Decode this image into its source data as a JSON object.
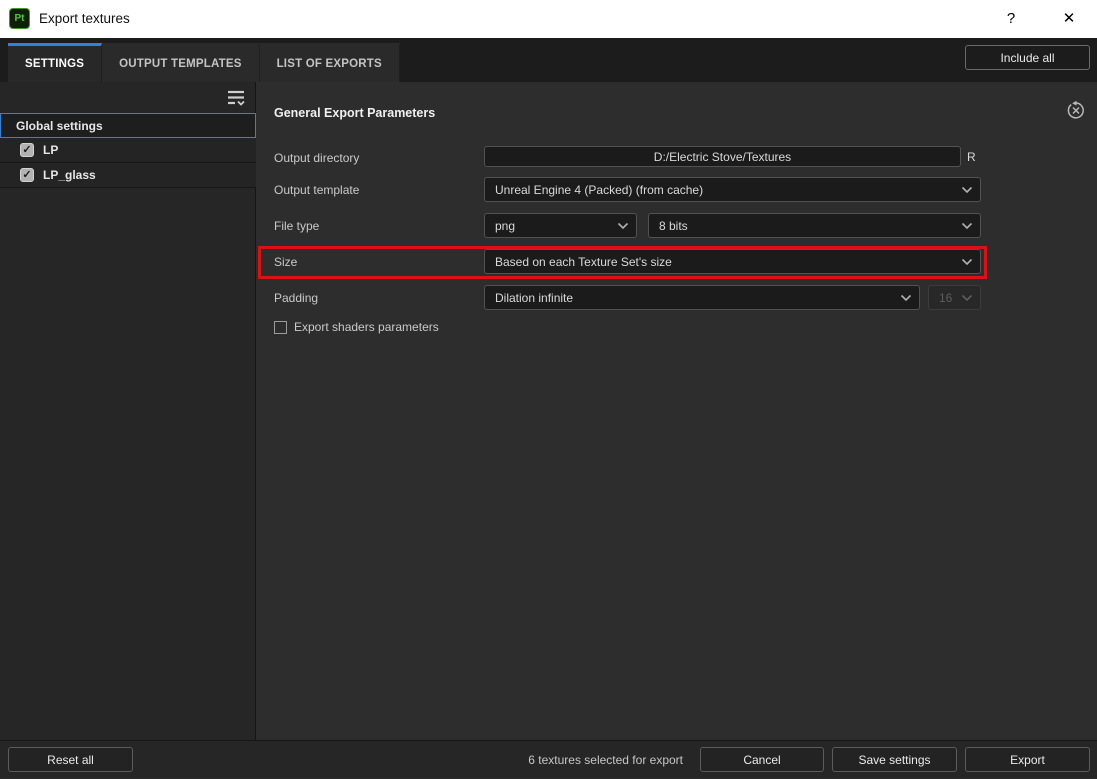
{
  "titlebar": {
    "app_icon": "Pt",
    "title": "Export textures",
    "help_glyph": "?",
    "close_glyph": "✕"
  },
  "header": {
    "tabs": [
      {
        "label": "SETTINGS",
        "active": true
      },
      {
        "label": "OUTPUT TEMPLATES",
        "active": false
      },
      {
        "label": "LIST OF EXPORTS",
        "active": false
      }
    ],
    "include_all": "Include all"
  },
  "sidebar": {
    "rows": [
      {
        "label": "Global settings",
        "selected": true
      },
      {
        "label": "LP",
        "checked": true
      },
      {
        "label": "LP_glass",
        "checked": true
      }
    ]
  },
  "main": {
    "section_title": "General Export Parameters",
    "output_directory": {
      "label": "Output directory",
      "value": "D:/Electric Stove/Textures",
      "suffix": "R"
    },
    "output_template": {
      "label": "Output template",
      "value": "Unreal Engine 4 (Packed) (from cache)"
    },
    "file_type": {
      "label": "File type",
      "format": "png",
      "bit_depth": "8 bits"
    },
    "size": {
      "label": "Size",
      "value": "Based on each Texture Set's size",
      "highlighted": true
    },
    "padding": {
      "label": "Padding",
      "value": "Dilation infinite",
      "amount": "16"
    },
    "export_shaders": {
      "label": "Export shaders parameters",
      "checked": false
    }
  },
  "footer": {
    "reset": "Reset all",
    "status": "6 textures selected for export",
    "cancel": "Cancel",
    "save": "Save settings",
    "export": "Export"
  },
  "icons": {
    "check": "✓"
  },
  "colors": {
    "accent_blue": "#2e82d8",
    "highlight_red": "#dd1111",
    "app_green": "#5ec43a",
    "titlebar_bg": "#ffffff"
  }
}
